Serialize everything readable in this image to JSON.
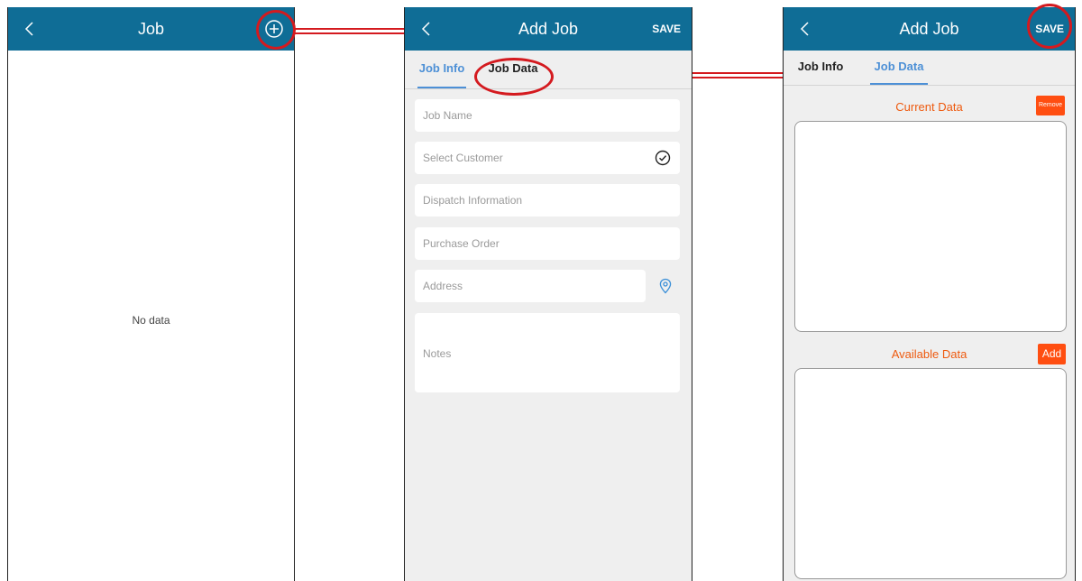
{
  "screen1": {
    "title": "Job",
    "empty_text": "No data"
  },
  "screen2": {
    "title": "Add Job",
    "save_label": "SAVE",
    "tabs": [
      "Job Info",
      "Job Data"
    ],
    "fields": {
      "job_name": "Job Name",
      "customer": "Select Customer",
      "dispatch": "Dispatch Information",
      "purchase_order": "Purchase Order",
      "address": "Address",
      "notes": "Notes"
    }
  },
  "screen3": {
    "title": "Add Job",
    "save_label": "SAVE",
    "tabs": [
      "Job Info",
      "Job Data"
    ],
    "current_title": "Current Data",
    "remove_label": "Remove",
    "available_title": "Available Data",
    "add_label": "Add"
  },
  "colors": {
    "header": "#0f6d96",
    "accent_tab": "#4d90d6",
    "orange": "#ff4e11",
    "highlight": "#d41a1f"
  },
  "icons": [
    "chevron-left-icon",
    "plus-circle-icon",
    "check-circle-icon",
    "location-pin-icon"
  ]
}
